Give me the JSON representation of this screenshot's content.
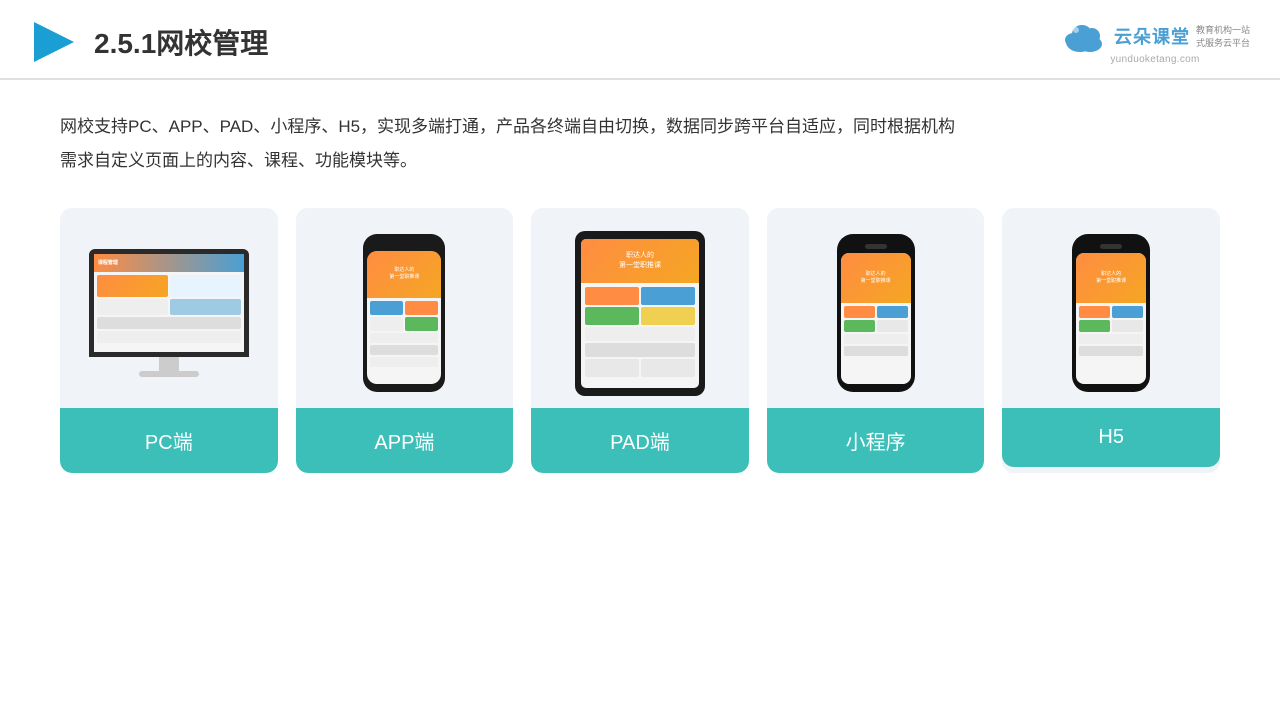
{
  "header": {
    "title": "2.5.1网校管理",
    "logo_text": "云朵课堂",
    "logo_url": "yunduoketang.com",
    "logo_tagline": "教育机构一站\n式服务云平台"
  },
  "description": "网校支持PC、APP、PAD、小程序、H5，实现多端打通，产品各终端自由切换，数据同步跨平台自适应，同时根据机构\n需求自定义页面上的内容、课程、功能模块等。",
  "cards": [
    {
      "id": "pc",
      "label": "PC端"
    },
    {
      "id": "app",
      "label": "APP端"
    },
    {
      "id": "pad",
      "label": "PAD端"
    },
    {
      "id": "mini",
      "label": "小程序"
    },
    {
      "id": "h5",
      "label": "H5"
    }
  ],
  "phone_header_text": "职达人的\n第一堂职推课",
  "screen_bar_label": "课程管理"
}
